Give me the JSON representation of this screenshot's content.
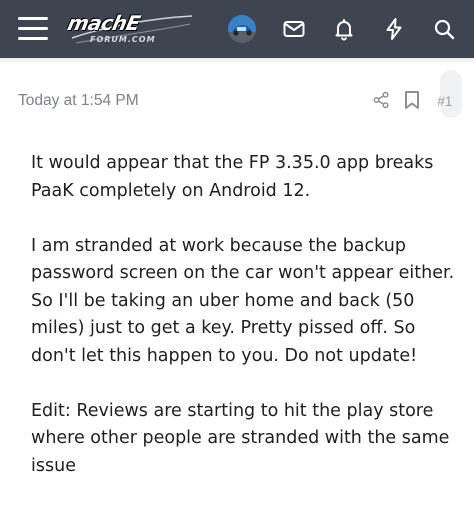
{
  "header": {
    "menu_icon": "hamburger-menu-icon",
    "logo_main": "machE",
    "logo_sub": "FORUM.COM",
    "icons": [
      "avatar",
      "envelope-icon",
      "bell-icon",
      "lightning-icon",
      "search-icon"
    ],
    "bar_color": "#3e4450"
  },
  "post": {
    "timestamp": "Today at 1:54 PM",
    "post_number": "#1",
    "actions": [
      "share-icon",
      "bookmark-icon"
    ],
    "paragraphs": [
      "It would appear that the FP 3.35.0 app breaks PaaK completely on Android 12.",
      "I am stranded at work because the backup password screen on the car won't appear either. So I'll be taking an uber home and back (50 miles) just to get a key. Pretty pissed off. So don't let this happen to you. Do not update!",
      "Edit: Reviews are starting to hit the play store where other people are stranded with the same issue"
    ]
  }
}
